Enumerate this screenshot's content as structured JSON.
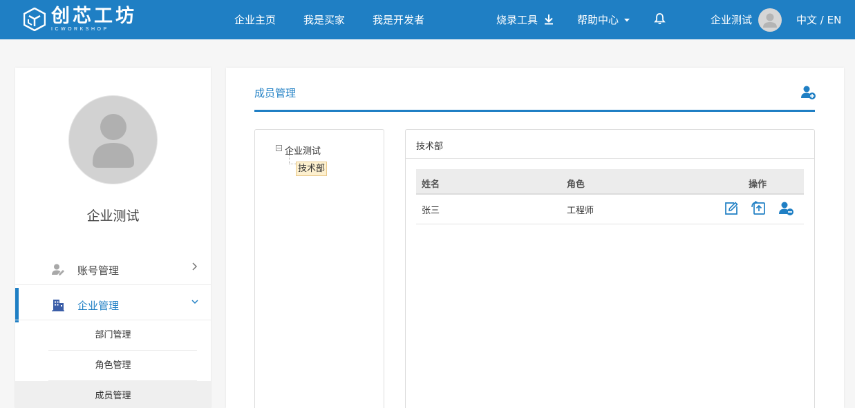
{
  "brand": {
    "title": "创芯工坊",
    "subtitle": "ICWORKSHOP",
    "color": "#1f7fc4"
  },
  "topnav": {
    "links": [
      "企业主页",
      "我是买家",
      "我是开发者"
    ],
    "burn_tool": "烧录工具",
    "help_center": "帮助中心",
    "user_name": "企业测试",
    "language": "中文 / EN",
    "icons": [
      "download-icon",
      "caret-down-icon",
      "bell-icon",
      "avatar"
    ]
  },
  "sidebar": {
    "company_name": "企业测试",
    "menu": [
      {
        "label": "账号管理",
        "icon": "user-edit-icon",
        "arrow": "chevron-right-icon"
      },
      {
        "label": "企业管理",
        "icon": "building-icon",
        "arrow": "chevron-down-icon"
      }
    ],
    "submenu": [
      "部门管理",
      "角色管理",
      "成员管理"
    ]
  },
  "main": {
    "title": "成员管理",
    "tree": {
      "root": "企业测试",
      "child": "技术部"
    },
    "department": {
      "title": "技术部",
      "columns": [
        "姓名",
        "角色",
        "操作"
      ],
      "rows": [
        {
          "name": "张三",
          "role": "工程师"
        }
      ]
    }
  }
}
